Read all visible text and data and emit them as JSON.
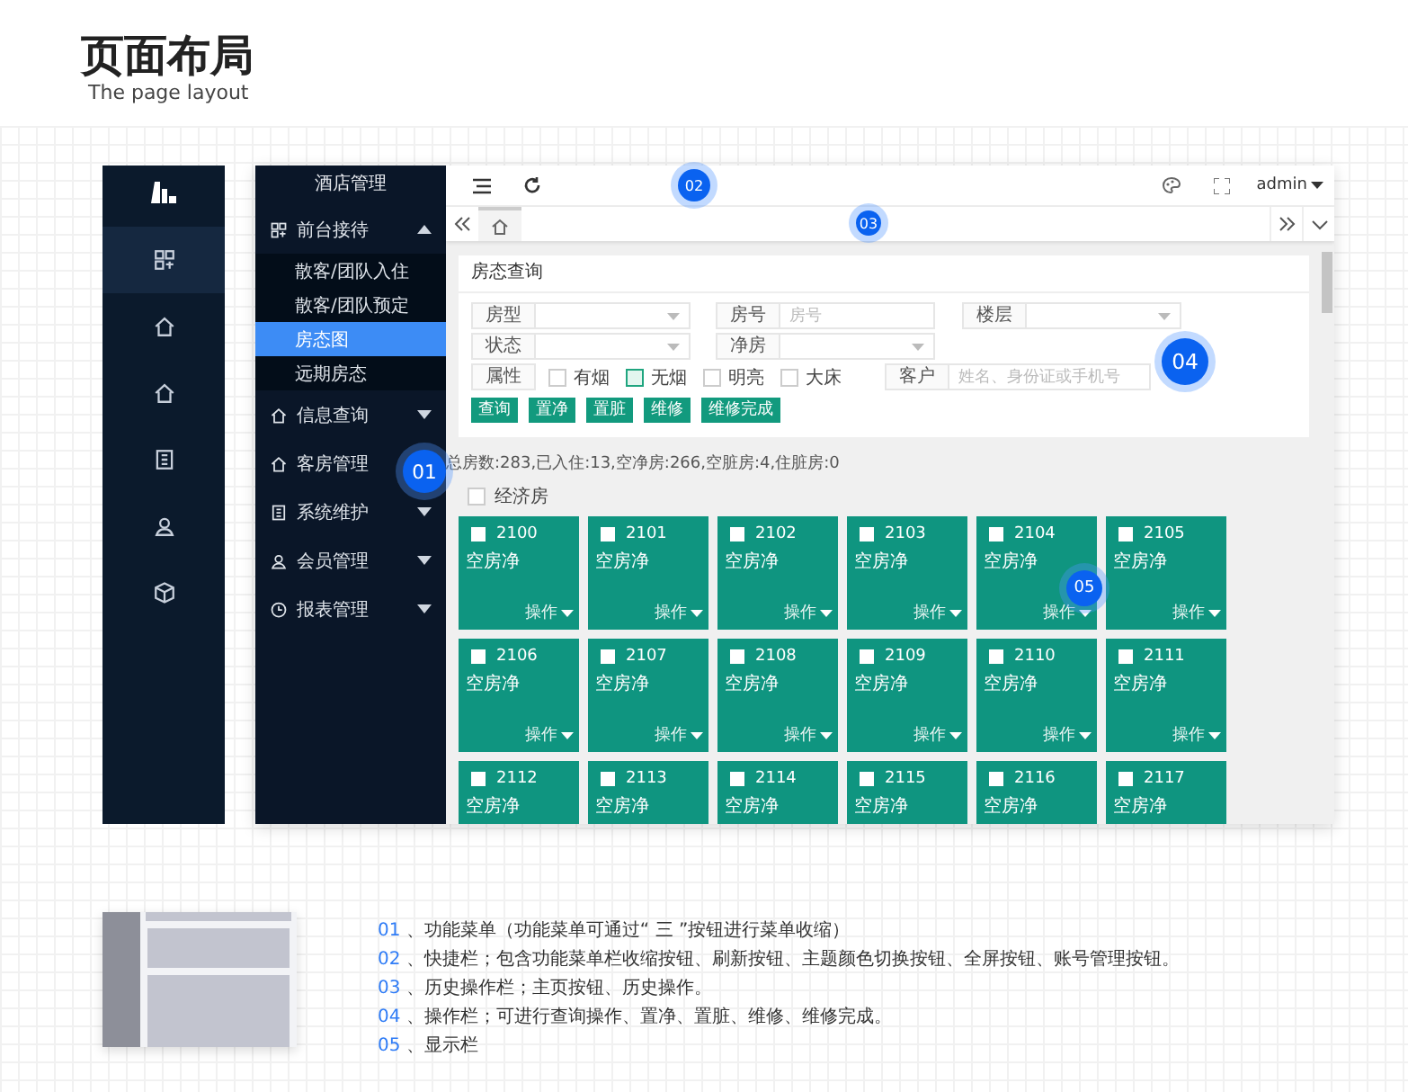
{
  "header": {
    "title": "页面布局",
    "subtitle": "The page layout"
  },
  "rail": {
    "items": [
      {
        "selected": true
      },
      {
        "selected": false
      },
      {
        "selected": false
      },
      {
        "selected": false
      },
      {
        "selected": false
      },
      {
        "selected": false
      }
    ]
  },
  "app": {
    "sidebar": {
      "title": "酒店管理",
      "menu": [
        {
          "label": "前台接待",
          "expanded": true,
          "children": [
            {
              "label": "散客/团队入住",
              "selected": false
            },
            {
              "label": "散客/团队预定",
              "selected": false
            },
            {
              "label": "房态图",
              "selected": true
            },
            {
              "label": "远期房态",
              "selected": false
            }
          ]
        },
        {
          "label": "信息查询",
          "expanded": false
        },
        {
          "label": "客房管理",
          "expanded": false
        },
        {
          "label": "系统维护",
          "expanded": false
        },
        {
          "label": "会员管理",
          "expanded": false
        },
        {
          "label": "报表管理",
          "expanded": false
        }
      ]
    },
    "topbar": {
      "user": "admin"
    },
    "query_card": {
      "title": "房态查询",
      "fields": [
        {
          "label": "房型",
          "kind": "select"
        },
        {
          "label": "房号",
          "kind": "input",
          "placeholder": "房号"
        },
        {
          "label": "楼层",
          "kind": "select"
        },
        {
          "label": "状态",
          "kind": "select"
        },
        {
          "label": "净房",
          "kind": "select"
        }
      ],
      "attributes": {
        "label": "属性",
        "options": [
          {
            "label": "有烟",
            "checked": false,
            "focused": false
          },
          {
            "label": "无烟",
            "checked": false,
            "focused": true
          },
          {
            "label": "明亮",
            "checked": false,
            "focused": false
          },
          {
            "label": "大床",
            "checked": false,
            "focused": false
          }
        ]
      },
      "customer": {
        "label": "客户",
        "placeholder": "姓名、身份证或手机号"
      },
      "buttons": [
        "查询",
        "置净",
        "置脏",
        "维修",
        "维修完成"
      ]
    },
    "summary": "总房数:283,已入住:13,空净房:266,空脏房:4,住脏房:0",
    "filter": {
      "label": "经济房",
      "checked": false
    },
    "rooms": [
      {
        "number": "2100",
        "status": "空房净",
        "checked": false,
        "action": "操作"
      },
      {
        "number": "2101",
        "status": "空房净",
        "checked": false,
        "action": "操作"
      },
      {
        "number": "2102",
        "status": "空房净",
        "checked": false,
        "action": "操作"
      },
      {
        "number": "2103",
        "status": "空房净",
        "checked": false,
        "action": "操作"
      },
      {
        "number": "2104",
        "status": "空房净",
        "checked": false,
        "action": "操作"
      },
      {
        "number": "2105",
        "status": "空房净",
        "checked": false,
        "action": "操作"
      },
      {
        "number": "2106",
        "status": "空房净",
        "checked": false,
        "action": "操作"
      },
      {
        "number": "2107",
        "status": "空房净",
        "checked": false,
        "action": "操作"
      },
      {
        "number": "2108",
        "status": "空房净",
        "checked": false,
        "action": "操作"
      },
      {
        "number": "2109",
        "status": "空房净",
        "checked": false,
        "action": "操作"
      },
      {
        "number": "2110",
        "status": "空房净",
        "checked": false,
        "action": "操作"
      },
      {
        "number": "2111",
        "status": "空房净",
        "checked": false,
        "action": "操作"
      },
      {
        "number": "2112",
        "status": "空房净",
        "checked": false
      },
      {
        "number": "2113",
        "status": "空房净",
        "checked": false
      },
      {
        "number": "2114",
        "status": "空房净",
        "checked": false
      },
      {
        "number": "2115",
        "status": "空房净",
        "checked": false
      },
      {
        "number": "2116",
        "status": "空房净",
        "checked": false
      },
      {
        "number": "2117",
        "status": "空房净",
        "checked": false
      }
    ]
  },
  "callouts": [
    "01",
    "02",
    "03",
    "04",
    "05"
  ],
  "legend": [
    {
      "number": "01",
      "text": "、功能菜单（功能菜单可通过“ 三 ”按钮进行菜单收缩）"
    },
    {
      "number": "02",
      "text": "、快捷栏；包含功能菜单栏收缩按钮、刷新按钮、主题颜色切换按钮、全屏按钮、账号管理按钮。"
    },
    {
      "number": "03",
      "text": "、历史操作栏；主页按钮、历史操作。"
    },
    {
      "number": "04",
      "text": "、操作栏；可进行查询操作、置净、置脏、维修、维修完成。"
    },
    {
      "number": "05",
      "text": "、显示栏"
    }
  ]
}
